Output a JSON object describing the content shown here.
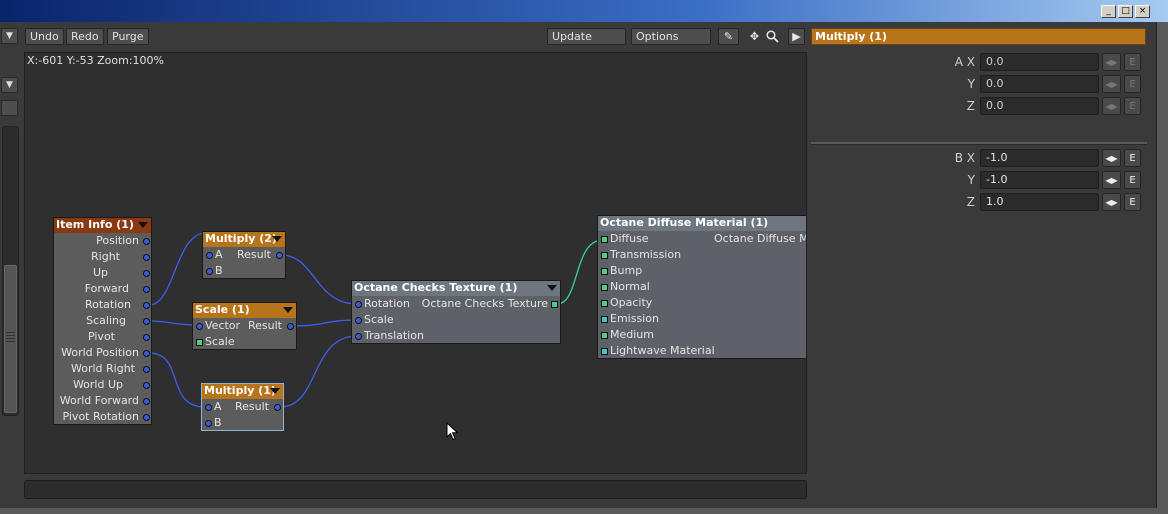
{
  "window": {
    "minimize": "_",
    "maximize": "□",
    "close": "×"
  },
  "toolbar": {
    "undo": "Undo",
    "redo": "Redo",
    "purge": "Purge",
    "update": "Update",
    "options": "Options"
  },
  "canvas": {
    "status": "X:-601 Y:-53 Zoom:100%"
  },
  "nodes": {
    "item_info": {
      "title": "Item Info (1)",
      "header_color": "#8a3a12",
      "outputs": [
        "Position",
        "Right",
        "Up",
        "Forward",
        "Rotation",
        "Scaling",
        "Pivot",
        "World Position",
        "World Right",
        "World Up",
        "World Forward",
        "Pivot Rotation"
      ]
    },
    "multiply2": {
      "title": "Multiply (2)",
      "header_color": "#b8741a",
      "input_a": "A",
      "input_b": "B",
      "output": "Result"
    },
    "scale1": {
      "title": "Scale (1)",
      "header_color": "#b8741a",
      "input_vector": "Vector",
      "input_scale": "Scale",
      "output": "Result"
    },
    "multiply1": {
      "title": "Multiply (1)",
      "header_color": "#b8741a",
      "input_a": "A",
      "input_b": "B",
      "output": "Result"
    },
    "checks": {
      "title": "Octane Checks Texture (1)",
      "header_color": "#6e7680",
      "inputs": [
        "Rotation",
        "Scale",
        "Translation"
      ],
      "output": "Octane Checks Texture"
    },
    "diffuse": {
      "title": "Octane Diffuse Material (1)",
      "header_color": "#6e7680",
      "inputs": [
        "Diffuse",
        "Transmission",
        "Bump",
        "Normal",
        "Opacity",
        "Emission",
        "Medium",
        "Lightwave Material"
      ],
      "output": "Octane Diffuse Mat"
    }
  },
  "panel": {
    "title": "Multiply (1)",
    "a": {
      "label_x": "A X",
      "label_y": "Y",
      "label_z": "Z",
      "x": "0.0",
      "y": "0.0",
      "z": "0.0"
    },
    "b": {
      "label_x": "B X",
      "label_y": "Y",
      "label_z": "Z",
      "x": "-1.0",
      "y": "-1.0",
      "z": "1.0"
    },
    "envelope_label": "E"
  }
}
